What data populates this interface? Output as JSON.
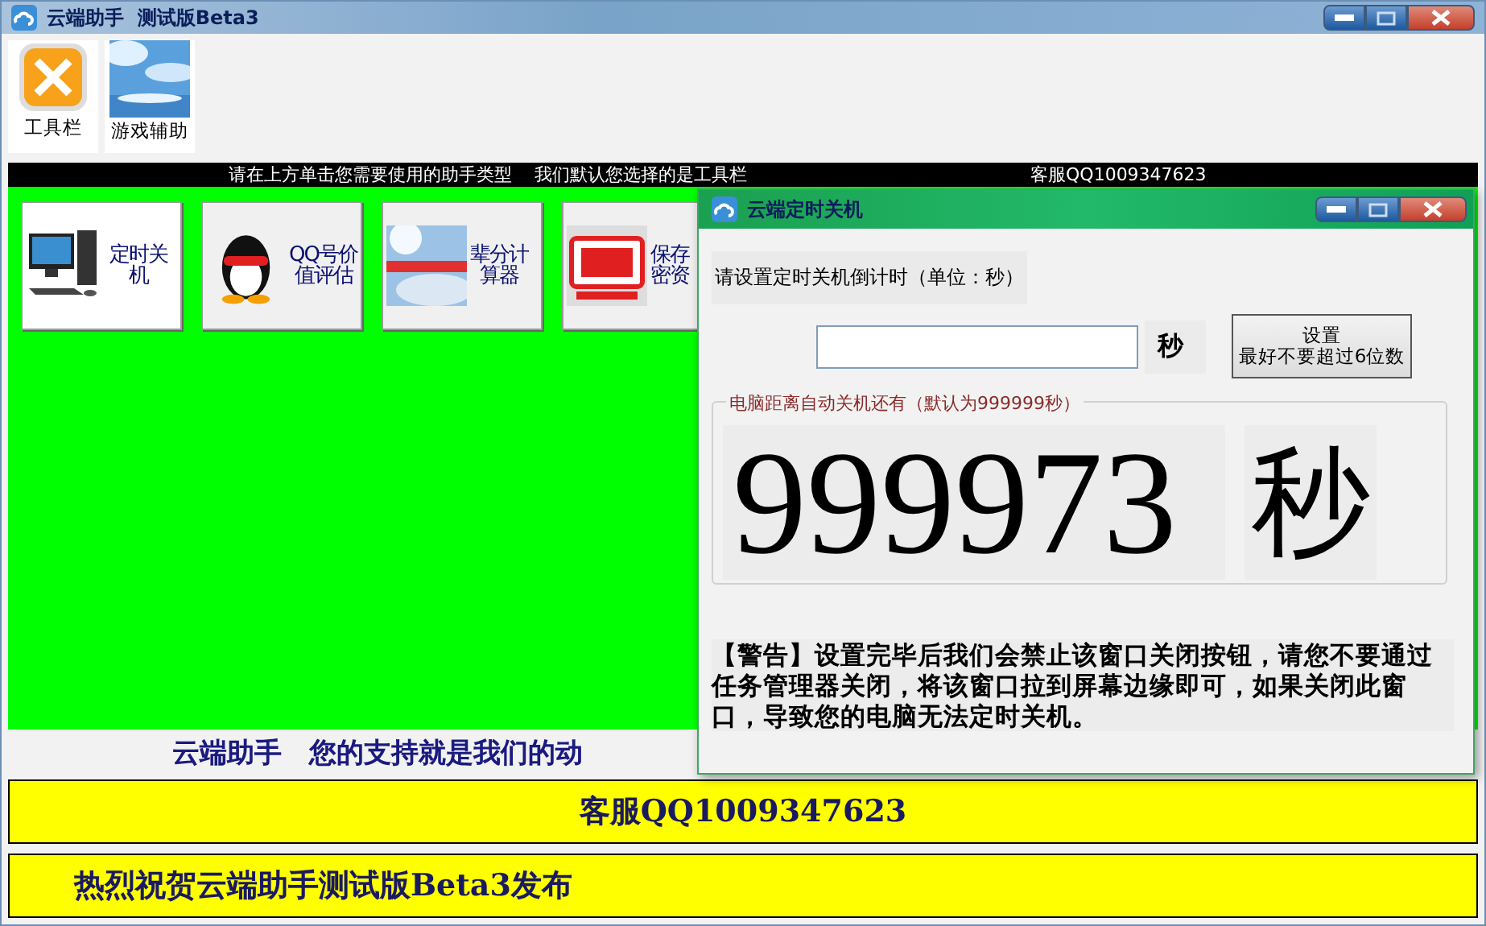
{
  "window": {
    "title": "云端助手  测试版Beta3"
  },
  "toolbar": [
    {
      "label": "工具栏",
      "kind": "tools"
    },
    {
      "label": "游戏辅助",
      "kind": "picture"
    }
  ],
  "info_bar": {
    "hint": "请在上方单击您需要使用的助手类型    我们默认您选择的是工具栏",
    "contact": "客服QQ1009347623"
  },
  "tools": [
    {
      "label_lines": [
        "定时关",
        "机"
      ],
      "kind": "computer",
      "selected": true
    },
    {
      "label_lines": [
        "QQ号价",
        "值评估"
      ],
      "kind": "penguin",
      "selected": false
    },
    {
      "label_lines": [
        "辈分计",
        "算器"
      ],
      "kind": "picture",
      "selected": false
    },
    {
      "label_lines": [
        "保存",
        "密资"
      ],
      "kind": "stamp",
      "selected": false
    }
  ],
  "caption": "云端助手　您的支持就是我们的动",
  "banners": [
    "客服QQ1009347623",
    "热烈祝贺云端助手测试版Beta3发布"
  ],
  "dialog": {
    "title": "云端定时关机",
    "prompt": "请设置定时关机倒计时（单位：秒）",
    "unit": "秒",
    "button": {
      "title": "设置",
      "subtitle": "最好不要超过6位数"
    },
    "group_label": "电脑距离自动关机还有（默认为999999秒）",
    "countdown": "999973",
    "countdown_unit": "秒",
    "warning": "【警告】设置完毕后我们会禁止该窗口关闭按钮，请您不要通过任务管理器关闭，将该窗口拉到屏幕边缘即可，如果关闭此窗口，导致您的电脑无法定时关机。"
  }
}
